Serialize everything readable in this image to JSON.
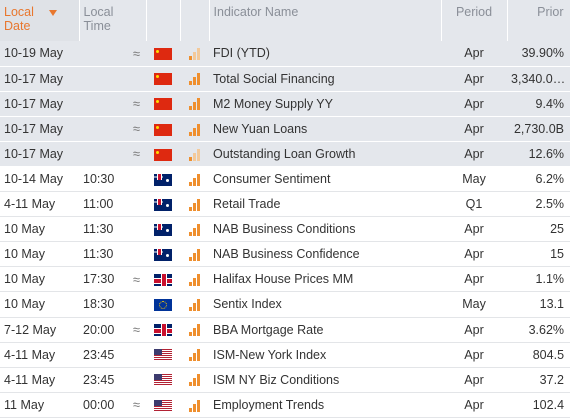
{
  "header": {
    "local_date_line1": "Local",
    "local_date_line2": "Date",
    "local_time_line1": "Local",
    "local_time_line2": "Time",
    "indicator_name": "Indicator Name",
    "period": "Period",
    "prior": "Prior"
  },
  "colors": {
    "accent": "#e8772e",
    "header_bg": "#e4e7ec",
    "importance_on": "#ef8f2e",
    "importance_off": "#f3c99a"
  },
  "rows": [
    {
      "date": "10-19 May",
      "time": "",
      "approx": "≈",
      "flag": "flag-cn",
      "country_icon": "china-flag-icon",
      "importance": 1,
      "name": "FDI (YTD)",
      "period": "Apr",
      "prior": "39.90%",
      "highlight": true
    },
    {
      "date": "10-17 May",
      "time": "",
      "approx": "",
      "flag": "flag-cn",
      "country_icon": "china-flag-icon",
      "importance": 3,
      "name": "Total Social Financing",
      "period": "Apr",
      "prior": "3,340.0…",
      "highlight": true
    },
    {
      "date": "10-17 May",
      "time": "",
      "approx": "≈",
      "flag": "flag-cn",
      "country_icon": "china-flag-icon",
      "importance": 3,
      "name": "M2 Money Supply YY",
      "period": "Apr",
      "prior": "9.4%",
      "highlight": true
    },
    {
      "date": "10-17 May",
      "time": "",
      "approx": "≈",
      "flag": "flag-cn",
      "country_icon": "china-flag-icon",
      "importance": 3,
      "name": "New Yuan Loans",
      "period": "Apr",
      "prior": "2,730.0B",
      "highlight": true
    },
    {
      "date": "10-17 May",
      "time": "",
      "approx": "≈",
      "flag": "flag-cn",
      "country_icon": "china-flag-icon",
      "importance": 1,
      "name": "Outstanding Loan Growth",
      "period": "Apr",
      "prior": "12.6%",
      "highlight": true
    },
    {
      "date": "10-14 May",
      "time": "10:30",
      "approx": "",
      "flag": "flag-au",
      "country_icon": "australia-flag-icon",
      "importance": 3,
      "name": "Consumer Sentiment",
      "period": "May",
      "prior": "6.2%",
      "highlight": false
    },
    {
      "date": "4-11 May",
      "time": "11:00",
      "approx": "",
      "flag": "flag-au",
      "country_icon": "australia-flag-icon",
      "importance": 3,
      "name": "Retail Trade",
      "period": "Q1",
      "prior": "2.5%",
      "highlight": false
    },
    {
      "date": "10 May",
      "time": "11:30",
      "approx": "",
      "flag": "flag-au",
      "country_icon": "australia-flag-icon",
      "importance": 3,
      "name": "NAB Business Conditions",
      "period": "Apr",
      "prior": "25",
      "highlight": false
    },
    {
      "date": "10 May",
      "time": "11:30",
      "approx": "",
      "flag": "flag-au",
      "country_icon": "australia-flag-icon",
      "importance": 3,
      "name": "NAB Business Confidence",
      "period": "Apr",
      "prior": "15",
      "highlight": false
    },
    {
      "date": "10 May",
      "time": "17:30",
      "approx": "≈",
      "flag": "flag-gb",
      "country_icon": "uk-flag-icon",
      "importance": 3,
      "name": "Halifax House Prices MM",
      "period": "Apr",
      "prior": "1.1%",
      "highlight": false
    },
    {
      "date": "10 May",
      "time": "18:30",
      "approx": "",
      "flag": "flag-eu",
      "country_icon": "eu-flag-icon",
      "importance": 3,
      "name": "Sentix Index",
      "period": "May",
      "prior": "13.1",
      "highlight": false
    },
    {
      "date": "7-12 May",
      "time": "20:00",
      "approx": "≈",
      "flag": "flag-gb",
      "country_icon": "uk-flag-icon",
      "importance": 3,
      "name": "BBA Mortgage Rate",
      "period": "Apr",
      "prior": "3.62%",
      "highlight": false
    },
    {
      "date": "4-11 May",
      "time": "23:45",
      "approx": "",
      "flag": "flag-us",
      "country_icon": "us-flag-icon",
      "importance": 3,
      "name": "ISM-New York Index",
      "period": "Apr",
      "prior": "804.5",
      "highlight": false
    },
    {
      "date": "4-11 May",
      "time": "23:45",
      "approx": "",
      "flag": "flag-us",
      "country_icon": "us-flag-icon",
      "importance": 3,
      "name": "ISM NY Biz Conditions",
      "period": "Apr",
      "prior": "37.2",
      "highlight": false
    },
    {
      "date": "11 May",
      "time": "00:00",
      "approx": "≈",
      "flag": "flag-us",
      "country_icon": "us-flag-icon",
      "importance": 3,
      "name": "Employment Trends",
      "period": "Apr",
      "prior": "102.4",
      "highlight": false
    }
  ]
}
